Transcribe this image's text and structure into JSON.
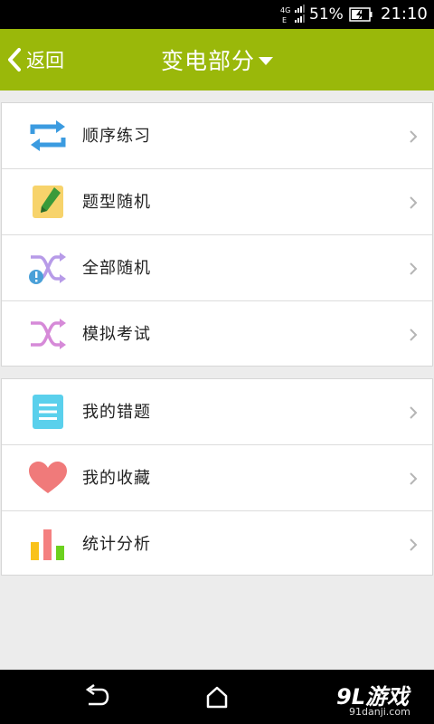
{
  "status_bar": {
    "network_top": "4G",
    "network_bottom": "E",
    "battery_percent": "51%",
    "time": "21:10"
  },
  "header": {
    "back_label": "返回",
    "title": "变电部分",
    "color": "#9ab80a"
  },
  "menu_group_1": [
    {
      "label": "顺序练习",
      "icon": "repeat-icon"
    },
    {
      "label": "题型随机",
      "icon": "pencil-note-icon"
    },
    {
      "label": "全部随机",
      "icon": "shuffle-alert-icon"
    },
    {
      "label": "模拟考试",
      "icon": "shuffle-icon"
    }
  ],
  "menu_group_2": [
    {
      "label": "我的错题",
      "icon": "document-list-icon"
    },
    {
      "label": "我的收藏",
      "icon": "heart-icon"
    },
    {
      "label": "统计分析",
      "icon": "bar-chart-icon"
    }
  ],
  "watermark": {
    "main": "9L游戏",
    "sub": "91danji.com"
  }
}
